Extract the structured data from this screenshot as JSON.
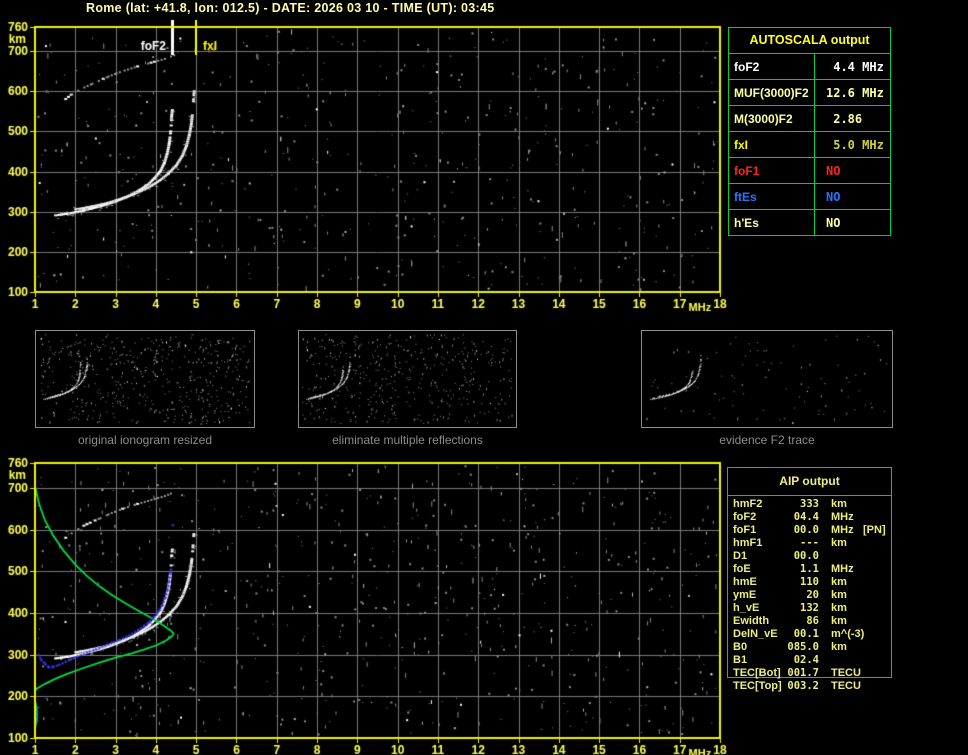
{
  "header": {
    "title": "Rome (lat: +41.8, lon: 012.5) - DATE: 2026 03 10 - TIME (UT): 03:45"
  },
  "colors": {
    "background": "#000000",
    "plot_border": "#f2f200",
    "axis_label_yellow": "#ffff55",
    "grid": "#787878",
    "table_border": "#00cc44",
    "title_text": "#ffffa8",
    "caption_gray": "#8c8c8c",
    "trace_white": "#ffffff",
    "profile_green": "#00dd44",
    "scaled_trace_blue": "#3a3aff",
    "aip_text": "#eded85"
  },
  "autoscala_table": {
    "title": "AUTOSCALA output",
    "rows": [
      {
        "param": "foF2",
        "value": " 4.4 MHz",
        "color": "#ffffff",
        "value_color": "#ffffff"
      },
      {
        "param": "MUF(3000)F2",
        "value": "12.6 MHz",
        "color": "#ffffa0",
        "value_color": "#ffffa0"
      },
      {
        "param": "M(3000)F2",
        "value": " 2.86",
        "color": "#ffffa0",
        "value_color": "#ffffa0"
      },
      {
        "param": "fxI",
        "value": " 5.0 MHz",
        "color": "#ffff00",
        "value_color": "#d2d23c"
      },
      {
        "param": "foF1",
        "value": "NO",
        "color": "#ff2222",
        "value_color": "#ff2222"
      },
      {
        "param": "ftEs",
        "value": "NO",
        "color": "#2277ff",
        "value_color": "#2277ff"
      },
      {
        "param": "h'Es",
        "value": "NO",
        "color": "#ffffa0",
        "value_color": "#ffffa0"
      }
    ]
  },
  "aip_table": {
    "title": "AIP output",
    "rows": [
      {
        "param": "hmF2",
        "value": "333",
        "unit": "km",
        "note": ""
      },
      {
        "param": "foF2",
        "value": "04.4",
        "unit": "MHz",
        "note": ""
      },
      {
        "param": "foF1",
        "value": "00.0",
        "unit": "MHz",
        "note": "[PN]"
      },
      {
        "param": "hmF1",
        "value": "---",
        "unit": "km",
        "note": ""
      },
      {
        "param": "D1",
        "value": "00.0",
        "unit": "",
        "note": ""
      },
      {
        "param": "foE",
        "value": "1.1",
        "unit": "MHz",
        "note": ""
      },
      {
        "param": "hmE",
        "value": "110",
        "unit": "km",
        "note": ""
      },
      {
        "param": "ymE",
        "value": "20",
        "unit": "km",
        "note": ""
      },
      {
        "param": "h_vE",
        "value": "132",
        "unit": "km",
        "note": ""
      },
      {
        "param": "Ewidth",
        "value": "86",
        "unit": "km",
        "note": ""
      },
      {
        "param": "DelN_vE",
        "value": "00.1",
        "unit": "m^(-3)",
        "note": ""
      },
      {
        "param": "B0",
        "value": "085.0",
        "unit": "km",
        "note": ""
      },
      {
        "param": "B1",
        "value": "02.4",
        "unit": "",
        "note": ""
      },
      {
        "param": "TEC[Bot]",
        "value": "001.7",
        "unit": "TECU",
        "note": ""
      },
      {
        "param": "TEC[Top]",
        "value": "003.2",
        "unit": "TECU",
        "note": ""
      }
    ]
  },
  "thumbnails": [
    {
      "caption": "original ionogram resized"
    },
    {
      "caption": "eliminate multiple reflections"
    },
    {
      "caption": "evidence F2 trace"
    }
  ],
  "chart_data": [
    {
      "id": "main_ionogram",
      "type": "scatter",
      "xlabel": "MHz",
      "ylabel": "km",
      "xlim": [
        1,
        18
      ],
      "ylim": [
        100,
        760
      ],
      "xticks": [
        1,
        2,
        3,
        4,
        5,
        6,
        7,
        8,
        9,
        10,
        11,
        12,
        13,
        14,
        15,
        16,
        17,
        18
      ],
      "yticks": [
        760,
        700,
        600,
        500,
        400,
        300,
        200,
        100
      ],
      "grid": true,
      "legend": "none",
      "markers": [
        {
          "label": "foF2",
          "freq_mhz": 4.4,
          "color": "#ffffff",
          "line_width": 3,
          "label_side": "left"
        },
        {
          "label": "fxI",
          "freq_mhz": 5.0,
          "color": "#ffff00",
          "line_width": 2,
          "label_side": "right"
        }
      ],
      "noise": {
        "count": 560,
        "seed": 7
      },
      "series": [
        {
          "name": "F2 trace O-mode",
          "style": "trace",
          "color": "#ffffff",
          "points": [
            [
              1.5,
              291
            ],
            [
              1.65,
              293
            ],
            [
              1.8,
              295
            ],
            [
              2.0,
              299
            ],
            [
              2.2,
              303
            ],
            [
              2.4,
              308
            ],
            [
              2.6,
              313
            ],
            [
              2.8,
              319
            ],
            [
              3.0,
              326
            ],
            [
              3.2,
              334
            ],
            [
              3.4,
              343
            ],
            [
              3.6,
              355
            ],
            [
              3.8,
              368
            ],
            [
              3.95,
              383
            ],
            [
              4.1,
              401
            ],
            [
              4.2,
              422
            ],
            [
              4.27,
              445
            ],
            [
              4.32,
              470
            ],
            [
              4.35,
              495
            ],
            [
              4.37,
              518
            ],
            [
              4.38,
              538
            ],
            [
              4.4,
              556
            ]
          ]
        },
        {
          "name": "F2 trace X-mode",
          "style": "trace",
          "color": "#f0f0f0",
          "points": [
            [
              2.0,
              306
            ],
            [
              2.2,
              309
            ],
            [
              2.4,
              313
            ],
            [
              2.6,
              317
            ],
            [
              2.8,
              322
            ],
            [
              3.0,
              328
            ],
            [
              3.2,
              335
            ],
            [
              3.45,
              344
            ],
            [
              3.7,
              355
            ],
            [
              3.9,
              366
            ],
            [
              4.1,
              379
            ],
            [
              4.3,
              395
            ],
            [
              4.5,
              416
            ],
            [
              4.65,
              440
            ],
            [
              4.75,
              465
            ],
            [
              4.82,
              492
            ],
            [
              4.87,
              520
            ],
            [
              4.9,
              548
            ],
            [
              4.92,
              575
            ],
            [
              4.94,
              602
            ]
          ]
        },
        {
          "name": "second reflection",
          "style": "dots",
          "color": "#c8c8c8",
          "points": [
            [
              1.75,
              583
            ],
            [
              1.9,
              595
            ],
            [
              2.05,
              604
            ],
            [
              2.2,
              612
            ],
            [
              2.4,
              621
            ],
            [
              2.6,
              630
            ],
            [
              2.8,
              639
            ],
            [
              3.0,
              647
            ],
            [
              3.2,
              654
            ],
            [
              3.45,
              662
            ],
            [
              3.7,
              669
            ],
            [
              3.95,
              676
            ],
            [
              4.2,
              683
            ],
            [
              4.35,
              689
            ],
            [
              4.5,
              695
            ]
          ]
        }
      ]
    },
    {
      "id": "profile_ionogram",
      "type": "scatter",
      "xlabel": "MHz",
      "ylabel": "km",
      "xlim": [
        1,
        18
      ],
      "ylim": [
        100,
        760
      ],
      "xticks": [
        1,
        2,
        3,
        4,
        5,
        6,
        7,
        8,
        9,
        10,
        11,
        12,
        13,
        14,
        15,
        16,
        17,
        18
      ],
      "yticks": [
        760,
        700,
        600,
        500,
        400,
        300,
        200,
        100
      ],
      "grid": true,
      "legend": "none",
      "markers": [],
      "series_from": 0,
      "include": [
        "F2 trace O-mode",
        "F2 trace X-mode",
        "second reflection"
      ],
      "noise": {
        "count": 720,
        "seed": 11
      },
      "series": [
        {
          "name": "electron density profile F-layer",
          "style": "line",
          "color": "#00dd44",
          "points": [
            [
              1.02,
              697
            ],
            [
              1.1,
              662
            ],
            [
              1.25,
              622
            ],
            [
              1.45,
              586
            ],
            [
              1.7,
              551
            ],
            [
              2.0,
              516
            ],
            [
              2.3,
              488
            ],
            [
              2.6,
              464
            ],
            [
              2.9,
              444
            ],
            [
              3.2,
              426
            ],
            [
              3.5,
              409
            ],
            [
              3.8,
              393
            ],
            [
              4.05,
              379
            ],
            [
              4.25,
              366
            ],
            [
              4.38,
              357
            ],
            [
              4.44,
              351
            ],
            [
              4.4,
              344
            ],
            [
              4.25,
              334
            ],
            [
              4.0,
              322
            ],
            [
              3.7,
              312
            ],
            [
              3.4,
              303
            ],
            [
              3.0,
              293
            ],
            [
              2.6,
              281
            ],
            [
              2.2,
              268
            ],
            [
              1.8,
              254
            ],
            [
              1.5,
              242
            ],
            [
              1.25,
              230
            ],
            [
              1.05,
              219
            ],
            [
              1.0,
              213
            ]
          ]
        },
        {
          "name": "electron density profile E-layer",
          "style": "line",
          "color": "#00dd44",
          "points": [
            [
              1.0,
              190
            ],
            [
              1.03,
              176
            ],
            [
              1.05,
              162
            ],
            [
              1.05,
              148
            ],
            [
              1.02,
              134
            ],
            [
              1.0,
              120
            ],
            [
              1.0,
              106
            ]
          ]
        },
        {
          "name": "autoscaled F2 trace",
          "style": "plus",
          "color": "#3a3aff",
          "points": [
            [
              1.07,
              300
            ],
            [
              1.15,
              288
            ],
            [
              1.25,
              278
            ],
            [
              1.33,
              271
            ],
            [
              1.45,
              272
            ],
            [
              1.6,
              277
            ],
            [
              1.75,
              284
            ],
            [
              1.9,
              291
            ],
            [
              2.05,
              297
            ],
            [
              2.2,
              303
            ],
            [
              2.35,
              309
            ],
            [
              2.5,
              314
            ],
            [
              2.65,
              320
            ],
            [
              2.8,
              326
            ],
            [
              2.95,
              331
            ],
            [
              3.1,
              337
            ],
            [
              3.25,
              344
            ],
            [
              3.4,
              351
            ],
            [
              3.55,
              360
            ],
            [
              3.7,
              370
            ],
            [
              3.85,
              381
            ],
            [
              3.95,
              392
            ],
            [
              4.05,
              404
            ],
            [
              4.15,
              420
            ],
            [
              4.22,
              438
            ],
            [
              4.28,
              458
            ],
            [
              4.32,
              478
            ],
            [
              4.35,
              497
            ],
            [
              4.37,
              510
            ]
          ]
        },
        {
          "name": "autoscaled isolated points",
          "style": "points",
          "color": "#3a3aff",
          "points": [
            [
              4.41,
              612
            ],
            [
              1.05,
              142
            ],
            [
              1.05,
              153
            ],
            [
              1.05,
              164
            ],
            [
              1.06,
              174
            ]
          ]
        }
      ]
    },
    {
      "id": "thumb_original",
      "type": "scatter",
      "kind": "thumbnail",
      "xlim": [
        1,
        18
      ],
      "ylim": [
        100,
        760
      ],
      "series_from": 0,
      "include": [
        "F2 trace O-mode",
        "F2 trace X-mode",
        "second reflection"
      ],
      "noise": {
        "count": 520,
        "seed": 3
      },
      "series": []
    },
    {
      "id": "thumb_no_reflections",
      "type": "scatter",
      "kind": "thumbnail",
      "xlim": [
        1,
        18
      ],
      "ylim": [
        100,
        760
      ],
      "series_from": 0,
      "include": [
        "F2 trace O-mode",
        "F2 trace X-mode",
        "second reflection"
      ],
      "noise": {
        "count": 430,
        "seed": 5
      },
      "series": []
    },
    {
      "id": "thumb_f2_trace",
      "type": "scatter",
      "kind": "thumbnail",
      "xlim": [
        1,
        18
      ],
      "ylim": [
        100,
        760
      ],
      "series_from": 0,
      "include": [
        "F2 trace O-mode",
        "F2 trace X-mode"
      ],
      "noise": {
        "count": 95,
        "seed": 9
      },
      "series": []
    }
  ]
}
